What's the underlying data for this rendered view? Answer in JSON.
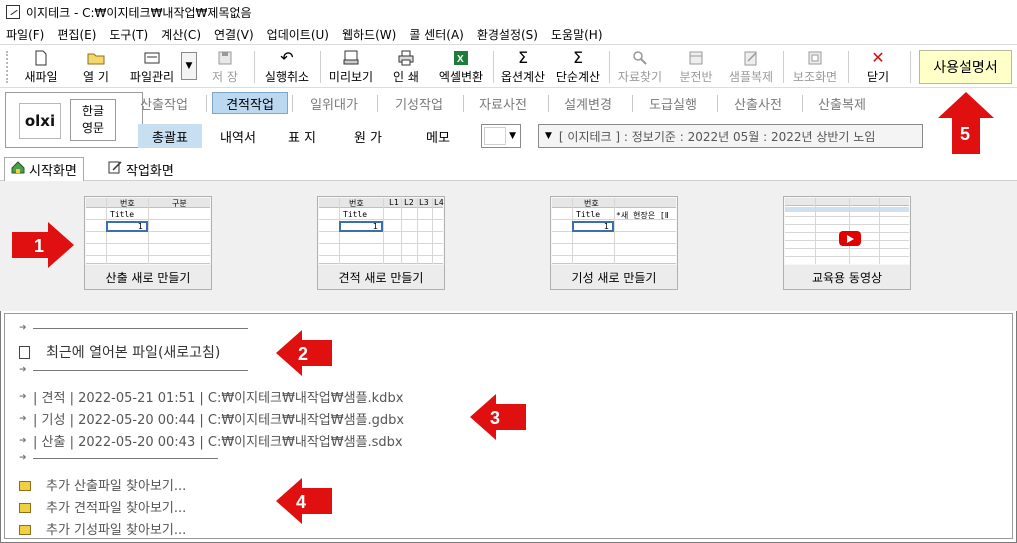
{
  "window": {
    "title": "이지테크 - C:₩이지테크₩내작업₩제목없음"
  },
  "menu": [
    "파일(F)",
    "편집(E)",
    "도구(T)",
    "계산(C)",
    "연결(V)",
    "업데이트(U)",
    "웹하드(W)",
    "콜 센터(A)",
    "환경설정(S)",
    "도움말(H)"
  ],
  "toolbar": {
    "buttons": [
      {
        "label": "새파일",
        "icon": "new-file-icon",
        "glyph": "🗋",
        "enabled": true
      },
      {
        "label": "열 기",
        "icon": "open-folder-icon",
        "glyph": "📂",
        "enabled": true
      },
      {
        "label": "파일관리",
        "icon": "file-manage-icon",
        "glyph": "▤",
        "enabled": true
      },
      {
        "label": "저 장",
        "icon": "save-icon",
        "glyph": "💾",
        "enabled": false
      },
      {
        "label": "실행취소",
        "icon": "undo-icon",
        "glyph": "↶",
        "enabled": true
      },
      {
        "label": "미리보기",
        "icon": "preview-icon",
        "glyph": "🖶",
        "enabled": true
      },
      {
        "label": "인 쇄",
        "icon": "printer-icon",
        "glyph": "🖨",
        "enabled": true
      },
      {
        "label": "엑셀변환",
        "icon": "excel-icon",
        "glyph": "X",
        "enabled": true
      },
      {
        "label": "옵션계산",
        "icon": "sigma-icon",
        "glyph": "Σ",
        "enabled": true
      },
      {
        "label": "단순계산",
        "icon": "sigma-icon",
        "glyph": "Σ",
        "enabled": true
      },
      {
        "label": "자료찾기",
        "icon": "magnifier-icon",
        "glyph": "🔍",
        "enabled": false
      },
      {
        "label": "분전반",
        "icon": "panel-icon",
        "glyph": "▦",
        "enabled": false
      },
      {
        "label": "샘플복제",
        "icon": "sample-copy-icon",
        "glyph": "✎",
        "enabled": false
      },
      {
        "label": "보조화면",
        "icon": "sub-screen-icon",
        "glyph": "▣",
        "enabled": false
      },
      {
        "label": "닫기",
        "icon": "close-icon",
        "glyph": "✕",
        "enabled": true
      }
    ],
    "manual_label": "사용설명서"
  },
  "logo": {
    "text": "olxi"
  },
  "lang": {
    "line1": "한글",
    "line2": "영문"
  },
  "tabs": [
    {
      "label": "산출작업",
      "active": false
    },
    {
      "label": "견적작업",
      "active": true
    },
    {
      "label": "일위대가",
      "active": false
    },
    {
      "label": "기성작업",
      "active": false
    },
    {
      "label": "자료사전",
      "active": false
    },
    {
      "label": "설계변경",
      "active": false
    },
    {
      "label": "도급실행",
      "active": false
    },
    {
      "label": "산출사전",
      "active": false
    },
    {
      "label": "산출복제",
      "active": false
    }
  ],
  "subtabs": [
    {
      "label": "총괄표",
      "active": true
    },
    {
      "label": "내역서",
      "active": false
    },
    {
      "label": "표 지",
      "active": false
    },
    {
      "label": "원 가",
      "active": false
    },
    {
      "label": "메모",
      "active": false
    }
  ],
  "info": "[ 이지테크 ] : 정보기준 : 2022년 05월 : 2022년 상반기 노임",
  "doctabs": [
    {
      "label": "시작화면",
      "icon": "home-icon",
      "active": true
    },
    {
      "label": "작업화면",
      "icon": "edit-icon",
      "active": false
    }
  ],
  "templates": [
    {
      "caption": "산출 새로 만들기",
      "headers": [
        "번호",
        "구분"
      ],
      "title": "Title",
      "value": "1",
      "note": ""
    },
    {
      "caption": "견적 새로 만들기",
      "headers": [
        "번호",
        "L1",
        "L2",
        "L3",
        "L4"
      ],
      "title": "Title",
      "value": "1",
      "note": ""
    },
    {
      "caption": "기성 새로 만들기",
      "headers": [
        "번호"
      ],
      "title": "Title",
      "value": "1",
      "note": "*새 현장은 [Ⅱ"
    },
    {
      "caption": "교육용 동영상",
      "headers": [],
      "title": "",
      "value": "",
      "note": ""
    }
  ],
  "recent": {
    "header": "최근에 열어본 파일(새로고침)",
    "files": [
      "| 견적 | 2022-05-21 01:51 | C:₩이지테크₩내작업₩샘플.kdbx",
      "| 기성 | 2022-05-20 00:44 | C:₩이지테크₩내작업₩샘플.gdbx",
      "| 산출 | 2022-05-20 00:43 | C:₩이지테크₩내작업₩샘플.sdbx"
    ],
    "browse": [
      "추가 산출파일 찾아보기...",
      "추가 견적파일 찾아보기...",
      "추가 기성파일 찾아보기..."
    ]
  },
  "annotations": {
    "color": "#e01010",
    "labels": [
      "1",
      "2",
      "3",
      "4",
      "5"
    ]
  }
}
